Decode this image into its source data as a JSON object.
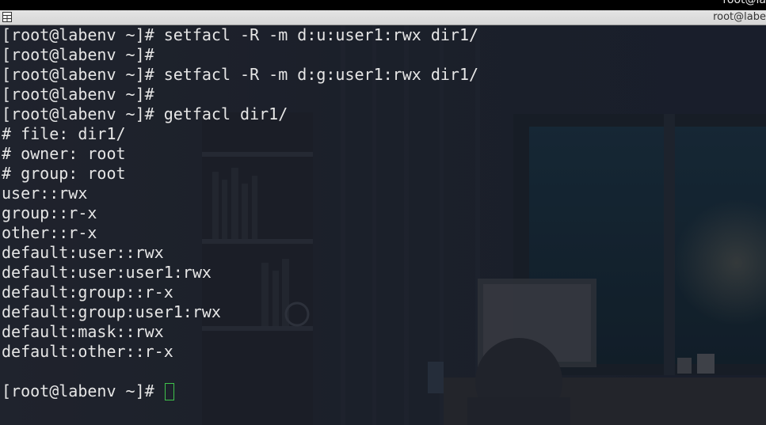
{
  "window": {
    "top_title": "root@la",
    "tab_title": "root@labe"
  },
  "terminal": {
    "lines": [
      "[root@labenv ~]# setfacl -R -m d:u:user1:rwx dir1/",
      "[root@labenv ~]#",
      "[root@labenv ~]# setfacl -R -m d:g:user1:rwx dir1/",
      "[root@labenv ~]#",
      "[root@labenv ~]# getfacl dir1/",
      "# file: dir1/",
      "# owner: root",
      "# group: root",
      "user::rwx",
      "group::r-x",
      "other::r-x",
      "default:user::rwx",
      "default:user:user1:rwx",
      "default:group::r-x",
      "default:group:user1:rwx",
      "default:mask::rwx",
      "default:other::r-x",
      "",
      "[root@labenv ~]# "
    ],
    "cursor_color": "#3fc24b"
  }
}
